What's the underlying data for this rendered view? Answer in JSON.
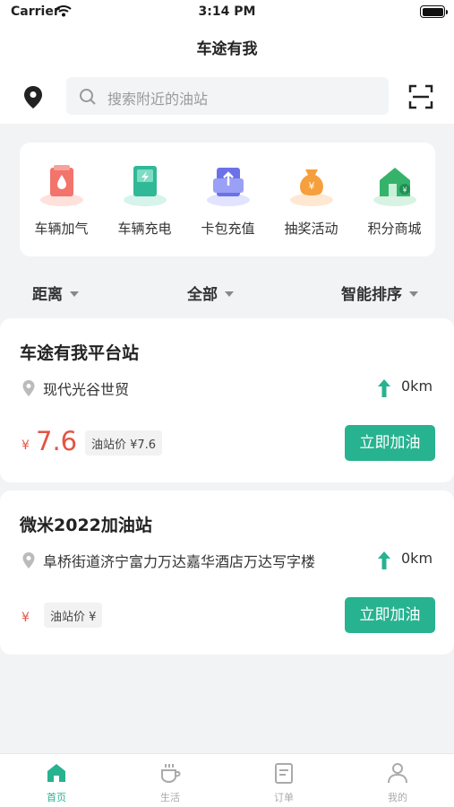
{
  "status_bar": {
    "carrier": "Carrier",
    "time": "3:14 PM"
  },
  "nav": {
    "title": "车途有我"
  },
  "search": {
    "placeholder": "搜索附近的油站"
  },
  "quick_actions": [
    {
      "label": "车辆加气",
      "icon": "gas-refill-icon"
    },
    {
      "label": "车辆充电",
      "icon": "ev-charge-icon"
    },
    {
      "label": "卡包充值",
      "icon": "card-topup-icon"
    },
    {
      "label": "抽奖活动",
      "icon": "lottery-bag-icon"
    },
    {
      "label": "积分商城",
      "icon": "points-store-icon"
    }
  ],
  "filters": {
    "distance": "距离",
    "all": "全部",
    "sort": "智能排序"
  },
  "stations": [
    {
      "name": "车途有我平台站",
      "address": "现代光谷世贸",
      "distance": "0km",
      "currency": "¥",
      "price": "7.6",
      "station_price_label": "油站价 ¥7.6",
      "button": "立即加油"
    },
    {
      "name": "微米2022加油站",
      "address": "阜桥街道济宁富力万达嘉华酒店万达写字楼",
      "distance": "0km",
      "currency": "¥",
      "price": "",
      "station_price_label": "油站价 ¥",
      "button": "立即加油"
    }
  ],
  "tabs": [
    {
      "label": "首页",
      "icon": "home-icon",
      "active": true
    },
    {
      "label": "生活",
      "icon": "cup-icon",
      "active": false
    },
    {
      "label": "订单",
      "icon": "order-list-icon",
      "active": false
    },
    {
      "label": "我的",
      "icon": "profile-icon",
      "active": false
    }
  ],
  "colors": {
    "accent": "#27b290",
    "price": "#e35445",
    "background": "#f2f3f5"
  }
}
